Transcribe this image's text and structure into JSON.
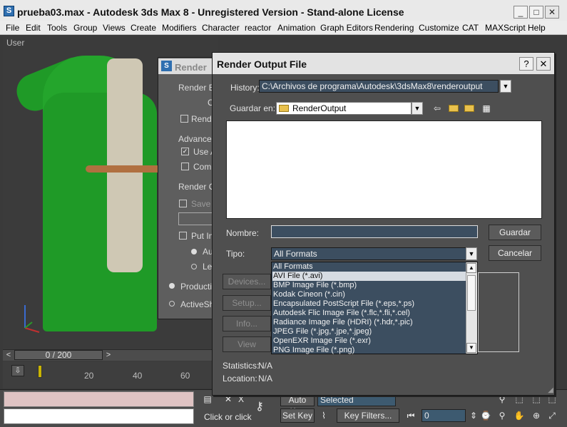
{
  "app": {
    "title": "prueba03.max - Autodesk 3ds Max 8  - Unregistered Version - Stand-alone License",
    "icon": "3ds-max-icon",
    "window_buttons": {
      "minimize": "_",
      "maximize": "□",
      "close": "✕"
    }
  },
  "menu": [
    "File",
    "Edit",
    "Tools",
    "Group",
    "Views",
    "Create",
    "Modifiers",
    "Character",
    "reactor",
    "Animation",
    "Graph Editors",
    "Rendering",
    "Customize",
    "CAT",
    "MAXScript",
    "Help"
  ],
  "viewport": {
    "label": "User"
  },
  "timeline": {
    "slider": "0 / 200",
    "prev": "<",
    "next": ">",
    "ticks": [
      "20",
      "40",
      "60"
    ]
  },
  "render_setup": {
    "title": "Render",
    "tab1": "Render E",
    "tab2": "C",
    "render_chk": "Rende",
    "advanced_group": "Advance",
    "use_a": "Use A",
    "comp": "Comp",
    "render_output_group": "Render O",
    "save": "Save",
    "put_im": "Put Im",
    "auto": "Au",
    "le": "Le",
    "production": "Productio",
    "activeshade": "ActiveSh"
  },
  "dialog": {
    "title": "Render Output File",
    "help_btn": "?",
    "close_btn": "✕",
    "history_label": "History:",
    "history_value": "C:\\Archivos de programa\\Autodesk\\3dsMax8\\renderoutput",
    "save_in_label": "Guardar en:",
    "save_in_value": "RenderOutput",
    "nav_icons": [
      "back-arrow-icon",
      "up-folder-icon",
      "new-folder-icon",
      "view-menu-icon"
    ],
    "name_label": "Nombre:",
    "name_value": "",
    "type_label": "Tipo:",
    "type_value": "All Formats",
    "save_button": "Guardar",
    "cancel_button": "Cancelar",
    "devices_button": "Devices...",
    "setup_button": "Setup...",
    "info_button": "Info...",
    "view_button": "View",
    "statistics_label": "Statistics:",
    "statistics_value": "N/A",
    "location_label": "Location:",
    "location_value": "N/A",
    "type_options": [
      "All Formats",
      "AVI File (*.avi)",
      "BMP Image File (*.bmp)",
      "Kodak Cineon (*.cin)",
      "Encapsulated PostScript File (*.eps,*.ps)",
      "Autodesk Flic Image File (*.flc,*.fli,*.cel)",
      "Radiance Image File (HDRI) (*.hdr,*.pic)",
      "JPEG File (*.jpg,*.jpe,*.jpeg)",
      "OpenEXR Image File (*.exr)",
      "PNG Image File (*.png)"
    ],
    "selected_option_index": 1
  },
  "status": {
    "prompt": "Click or click",
    "auto_key": "Auto Key",
    "selected": "Selected",
    "set_key": "Set Key",
    "key_filters": "Key Filters...",
    "frame": "0"
  },
  "colors": {
    "robe": "#1f9a27",
    "trim": "#cfc8b4",
    "field_blue": "#3c4e60",
    "dialog_bg": "#4f4f4f"
  }
}
